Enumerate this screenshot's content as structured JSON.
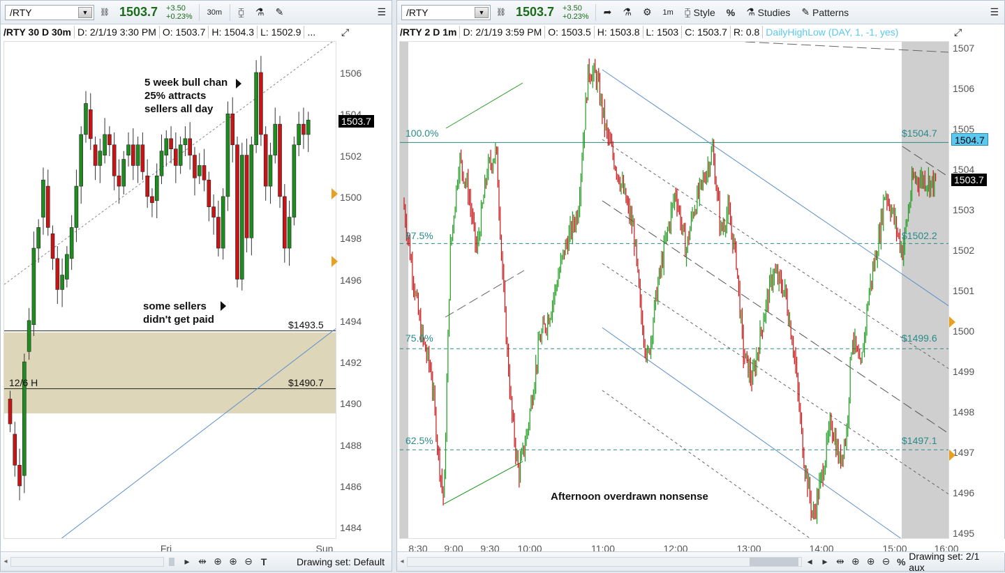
{
  "left": {
    "toolbar": {
      "symbol": "/RTY",
      "price": "1503.7",
      "change": "+3.50",
      "change_pct": "+0.23%",
      "timeframe": "30m"
    },
    "info": {
      "title": "/RTY 30 D 30m",
      "date": "D: 2/1/19 3:30 PM",
      "open": "O: 1503.7",
      "high": "H: 1504.3",
      "low": "L: 1502.9",
      "more": "..."
    },
    "price_axis": {
      "ticks": [
        "1506",
        "1504",
        "1502",
        "1500",
        "1498",
        "1496",
        "1494",
        "1492",
        "1490",
        "1488",
        "1486",
        "1484"
      ],
      "last_price_tag": "1503.7"
    },
    "time_axis": {
      "labels": [
        "Fri",
        "Sun"
      ]
    },
    "annotations": {
      "bull_chan": [
        "5 week bull chan",
        "25% attracts",
        "sellers all day"
      ],
      "sellers": [
        "some sellers",
        "didn't get paid"
      ],
      "level_high": "$1493.5",
      "level_low": "$1490.7",
      "prev_high": "12/6 H"
    },
    "bottom": {
      "drawing_set": "Drawing set: Default"
    },
    "colors": {
      "up": "#1e8c1e",
      "down": "#c81414",
      "zone": "#ddd6b8",
      "channel": "#5b8fc9"
    }
  },
  "right": {
    "toolbar": {
      "symbol": "/RTY",
      "price": "1503.7",
      "change": "+3.50",
      "change_pct": "+0.23%",
      "timeframe": "1m",
      "style": "Style",
      "studies": "Studies",
      "patterns": "Patterns",
      "percent": "%"
    },
    "info": {
      "title": "/RTY 2 D 1m",
      "date": "D: 2/1/19 3:59 PM",
      "open": "O: 1503.5",
      "high": "H: 1503.8",
      "low": "L: 1503",
      "close": "C: 1503.7",
      "range": "R: 0.8",
      "study": "DailyHighLow (DAY, 1, -1, yes)"
    },
    "price_axis": {
      "ticks": [
        "1507",
        "1506",
        "1505",
        "1504",
        "1503",
        "1502",
        "1501",
        "1500",
        "1499",
        "1498",
        "1497",
        "1496",
        "1495"
      ],
      "fib_tag": "1504.7",
      "last_price_tag": "1503.7"
    },
    "time_axis": {
      "labels": [
        "8:30",
        "9:00",
        "9:30",
        "10:00",
        "11:00",
        "12:00",
        "13:00",
        "14:00",
        "15:00",
        "16:00"
      ]
    },
    "fib_levels": [
      {
        "pct": "100.0%",
        "price": "$1504.7"
      },
      {
        "pct": "87.5%",
        "price": "$1502.2"
      },
      {
        "pct": "75.0%",
        "price": "$1499.6"
      },
      {
        "pct": "62.5%",
        "price": "$1497.1"
      }
    ],
    "annotation": "Afternoon overdrawn nonsense",
    "bottom": {
      "drawing_set": "Drawing set: 2/1 aux"
    },
    "colors": {
      "up": "#1e9c1e",
      "down": "#c81414",
      "fib": "#2a8a8a",
      "channel": "#5b8fc9",
      "highlight": "#cfcfcf"
    }
  }
}
